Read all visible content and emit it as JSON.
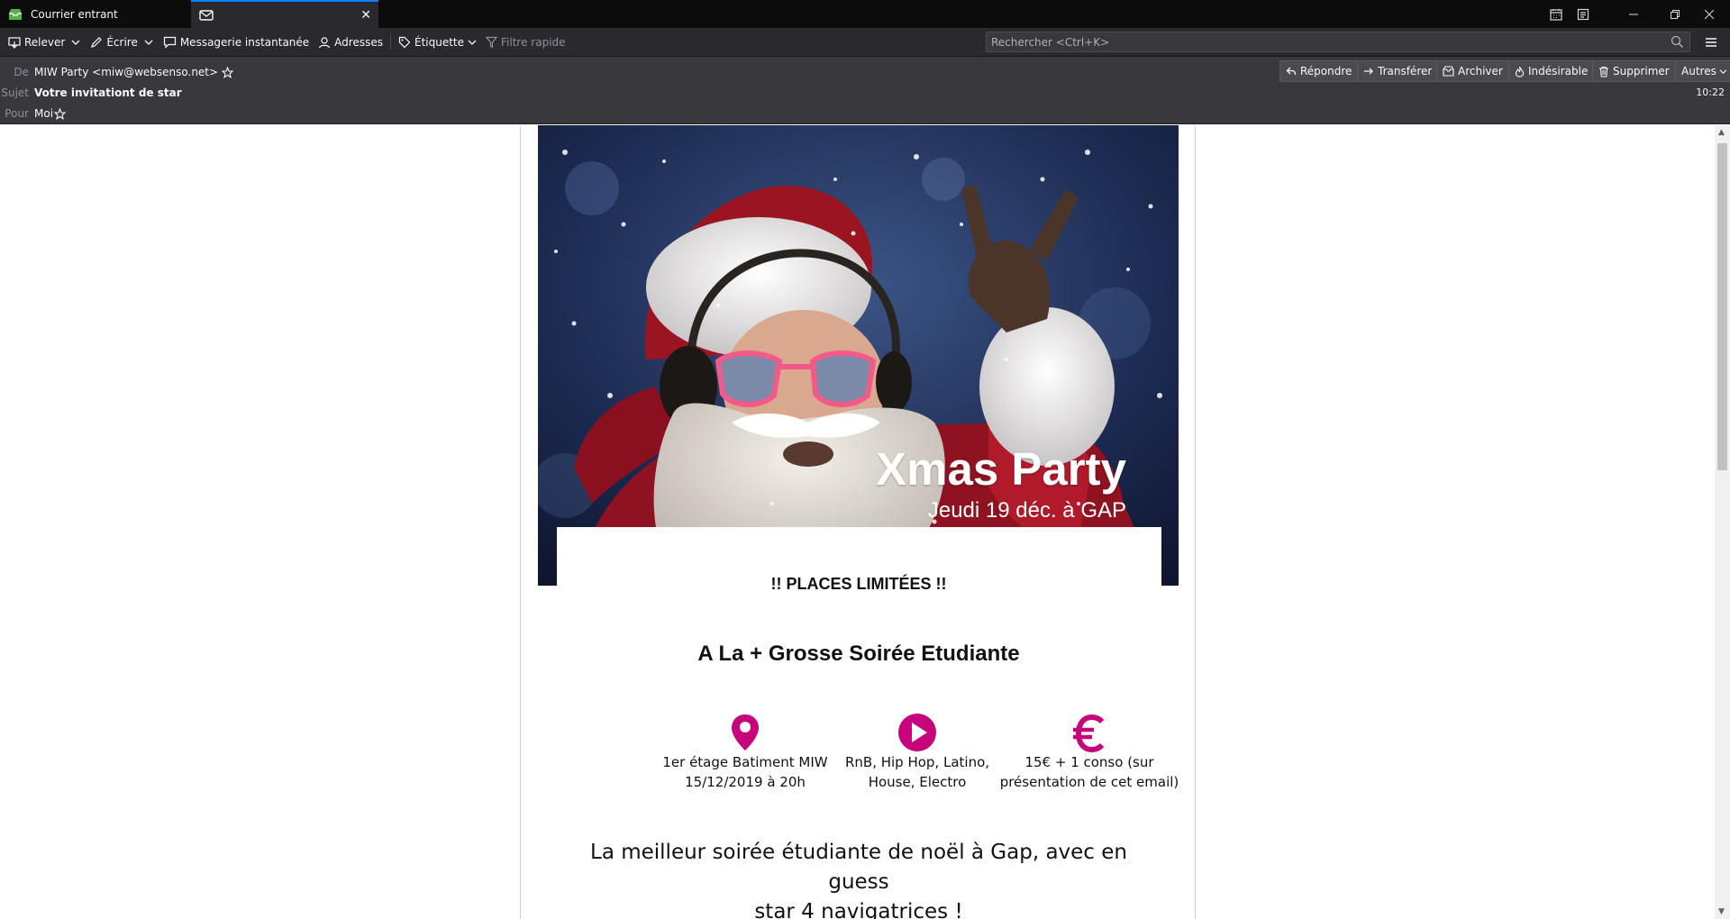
{
  "tabs": {
    "inbox_label": "Courrier entrant",
    "close_glyph": "✕"
  },
  "toolbar": {
    "get_messages": "Relever",
    "write": "Écrire",
    "chat": "Messagerie instantanée",
    "address_book": "Adresses",
    "tag": "Étiquette",
    "quick_filter": "Filtre rapide",
    "search_placeholder": "Rechercher <Ctrl+K>"
  },
  "header": {
    "from_label": "De",
    "from_value": "MIW Party <miw@websenso.net>",
    "subject_label": "Sujet",
    "subject_value": "Votre invitationt de star",
    "to_label": "Pour",
    "to_value": "Moi",
    "time": "10:22",
    "actions": {
      "reply": "Répondre",
      "forward": "Transférer",
      "archive": "Archiver",
      "junk": "Indésirable",
      "delete": "Supprimer",
      "other": "Autres"
    }
  },
  "message": {
    "hero_title": "Xmas Party",
    "hero_subtitle": "Jeudi 19 déc. à GAP",
    "limited": "!! PLACES LIMITÉES !!",
    "headline": "A La + Grosse Soirée Etudiante",
    "features": [
      {
        "icon": "map-pin-icon",
        "line1": "1er étage Batiment MIW",
        "line2": "15/12/2019 à 20h"
      },
      {
        "icon": "play-icon",
        "line1": "RnB, Hip Hop, Latino,",
        "line2": "House, Electro"
      },
      {
        "icon": "euro-icon",
        "line1": "15€ + 1 conso (sur",
        "line2": "présentation de cet email)"
      }
    ],
    "tagline_line1": "La meilleur soirée étudiante de noël à Gap, avec en guess",
    "tagline_line2": "star 4 navigatrices !"
  },
  "colors": {
    "accent": "#c8047d",
    "tab_highlight": "#0a84ff",
    "toolbar_bg": "#2a2a2e",
    "header_bg": "#38383d"
  }
}
